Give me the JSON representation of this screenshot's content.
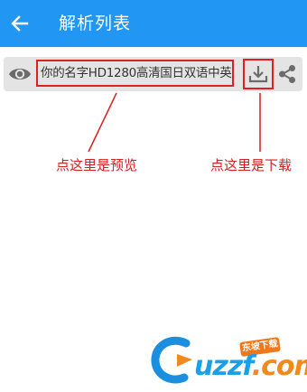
{
  "app_bar": {
    "title": "解析列表",
    "back_icon": "arrow-left-icon",
    "background_color": "#2196f3"
  },
  "file_row": {
    "preview_icon": "eye-icon",
    "file_name": "你的名字HD1280高清国日双语中英.",
    "download_icon": "download-icon",
    "share_icon": "share-icon"
  },
  "annotations": {
    "preview_note": "点这里是预览",
    "download_note": "点这里是下载",
    "color": "#d42020"
  },
  "watermark": {
    "brand_text": "uzzf",
    "brand_suffix": ".com",
    "badge_text": "东坡下载"
  }
}
